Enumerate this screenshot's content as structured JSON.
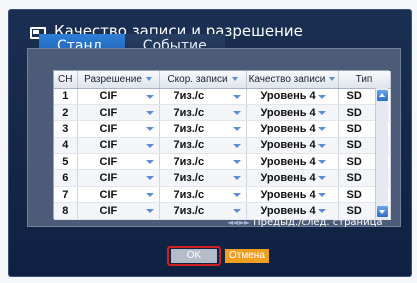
{
  "dialog": {
    "title": "Качество записи и разрешение",
    "icon": "monitor-icon"
  },
  "tabs": [
    {
      "label": "Станд.",
      "active": true
    },
    {
      "label": "Событие",
      "active": false
    }
  ],
  "table": {
    "headers": {
      "ch": "CH",
      "resolution": "Разрешение",
      "speed": "Скор. записи",
      "quality": "Качество записи",
      "type": "Тип"
    },
    "rows": [
      {
        "ch": "1",
        "resolution": "CIF",
        "speed": "7из./c",
        "quality": "Уровень 4",
        "type": "SD"
      },
      {
        "ch": "2",
        "resolution": "CIF",
        "speed": "7из./c",
        "quality": "Уровень 4",
        "type": "SD"
      },
      {
        "ch": "3",
        "resolution": "CIF",
        "speed": "7из./c",
        "quality": "Уровень 4",
        "type": "SD"
      },
      {
        "ch": "4",
        "resolution": "CIF",
        "speed": "7из./c",
        "quality": "Уровень 4",
        "type": "SD"
      },
      {
        "ch": "5",
        "resolution": "CIF",
        "speed": "7из./c",
        "quality": "Уровень 4",
        "type": "SD"
      },
      {
        "ch": "6",
        "resolution": "CIF",
        "speed": "7из./c",
        "quality": "Уровень 4",
        "type": "SD"
      },
      {
        "ch": "7",
        "resolution": "CIF",
        "speed": "7из./c",
        "quality": "Уровень 4",
        "type": "SD"
      },
      {
        "ch": "8",
        "resolution": "CIF",
        "speed": "7из./c",
        "quality": "Уровень 4",
        "type": "SD"
      }
    ]
  },
  "pager": {
    "label": "Предыд./след. страница",
    "icons": "◄◄ ►►"
  },
  "buttons": {
    "ok": "OK",
    "cancel": "Отмена"
  },
  "colors": {
    "dialog_bg": "#0f2142",
    "active_tab": "#2e7fd8",
    "cancel_button": "#f0a020",
    "focus_border": "#d02020"
  }
}
